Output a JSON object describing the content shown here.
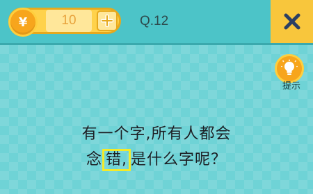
{
  "header": {
    "coin_symbol": "¥",
    "coin_count": "10",
    "question_label": "Q.12",
    "close_label": "X"
  },
  "hint": {
    "label": "提示"
  },
  "puzzle": {
    "line1": "有一个字,所有人都会",
    "line2_prefix": "念",
    "line2_highlight": "错,",
    "line2_suffix": "是什么字呢？"
  },
  "colors": {
    "background": "#6fd3d6",
    "topbar": "#4cc4c8",
    "coin_gold": "#f7a51c",
    "pill_yellow": "#ffd24a",
    "close_button": "#f8c63c",
    "highlight_border": "#f4ea2a"
  },
  "icons": {
    "coin": "yen-coin-icon",
    "add": "plus-icon",
    "close": "x-icon",
    "hint": "lightbulb-icon"
  }
}
